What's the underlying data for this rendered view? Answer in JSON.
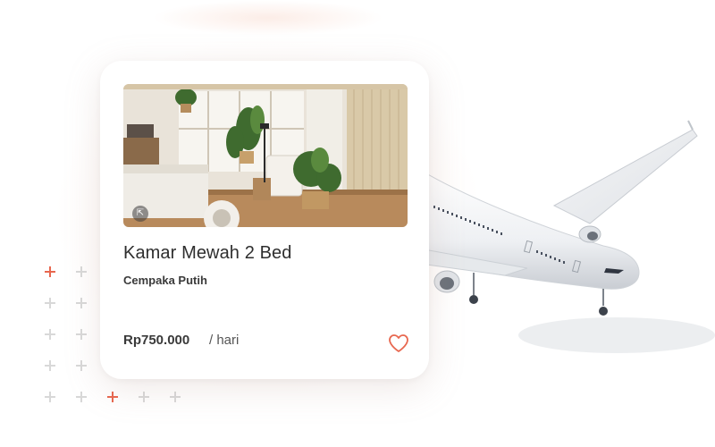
{
  "listing": {
    "title": "Kamar Mewah 2 Bed",
    "location": "Cempaka Putih",
    "price": "Rp750.000",
    "unit": "/ hari",
    "favorite_icon": "heart-icon",
    "photo_badge_icon": "expand-icon",
    "accent_color": "#e8674f"
  }
}
